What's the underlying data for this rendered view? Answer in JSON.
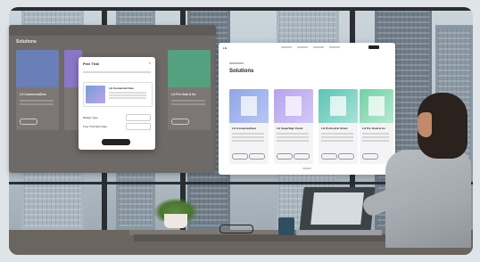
{
  "scene": {
    "description_free": true
  },
  "left_screen": {
    "title": "Solutions",
    "cards": [
      {
        "name": "LG CommercialDuo",
        "color": "#6a7fb8"
      },
      {
        "name": "",
        "color": "#8a77c7"
      },
      {
        "name": "LG Pro Grab & Go",
        "color": "#55a07e"
      }
    ]
  },
  "dialog": {
    "title": "Free Trial",
    "close_icon": "close-icon",
    "product_name": "LG Connected Care",
    "field_labels": [
      "Budget Type",
      "Free Trial Start Date"
    ],
    "submit_label": ""
  },
  "right_screen": {
    "title": "Solutions",
    "cards": [
      {
        "name": "LG ConnectedCare",
        "color": "#8fa6e6"
      },
      {
        "name": "LG SuperSign Cloud",
        "color": "#b5a3ec"
      },
      {
        "name": "LG ProCentric Smart",
        "color": "#5cc3b4"
      },
      {
        "name": "LG Pro Grab & Go",
        "color": "#6fd0a5"
      }
    ]
  }
}
